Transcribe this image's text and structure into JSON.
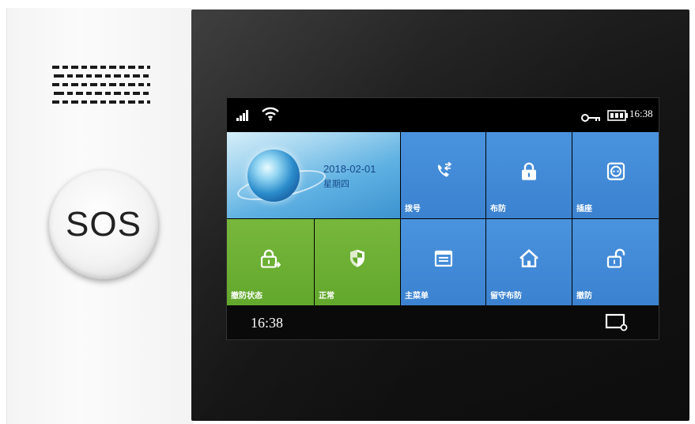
{
  "device": {
    "sos_label": "SOS"
  },
  "statusbar": {
    "time": "16:38",
    "icons": [
      "signal-icon",
      "wifi-icon",
      "key-icon",
      "battery-icon"
    ]
  },
  "date_tile": {
    "date": "2018-02-01",
    "weekday": "星期四"
  },
  "tiles": [
    {
      "label": "拨号",
      "icon": "phone-icon",
      "color": "#4a8fd8"
    },
    {
      "label": "布防",
      "icon": "lock-icon",
      "color": "#4a8fd8"
    },
    {
      "label": "插座",
      "icon": "socket-icon",
      "color": "#4a8fd8"
    },
    {
      "label": "撤防状态",
      "icon": "unlock-icon",
      "color": "#6aae33"
    },
    {
      "label": "正常",
      "icon": "shield-icon",
      "color": "#6aae33"
    },
    {
      "label": "主菜单",
      "icon": "menu-icon",
      "color": "#4a8fd8"
    },
    {
      "label": "留守布防",
      "icon": "home-icon",
      "color": "#4a8fd8"
    },
    {
      "label": "撤防",
      "icon": "open-lock-icon",
      "color": "#4a8fd8"
    }
  ],
  "bottombar": {
    "time": "16:38",
    "icon": "screen-icon"
  }
}
